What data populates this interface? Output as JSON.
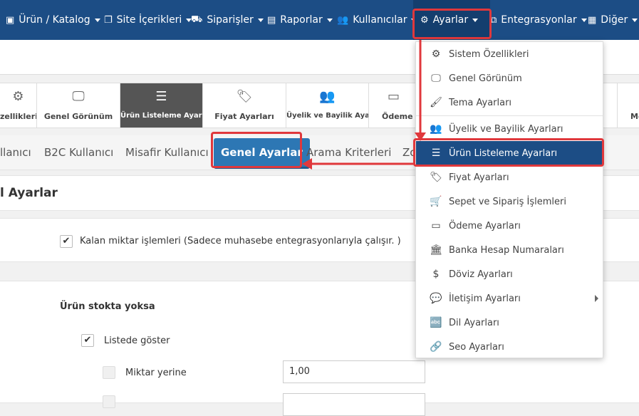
{
  "topnav": {
    "items": [
      {
        "label": "Ürün / Katalog",
        "icon": "cubes-icon"
      },
      {
        "label": "Site İçerikleri",
        "icon": "copy-icon"
      },
      {
        "label": "Siparişler",
        "icon": "truck-icon"
      },
      {
        "label": "Raporlar",
        "icon": "file-chart-icon"
      },
      {
        "label": "Kullanıcılar",
        "icon": "users-icon"
      },
      {
        "label": "Ayarlar",
        "icon": "gears-icon"
      },
      {
        "label": "Entegrasyonlar",
        "icon": "sitemap-icon"
      },
      {
        "label": "Diğer",
        "icon": "grid-icon"
      }
    ]
  },
  "tiles": [
    {
      "label": "zellikleri",
      "icon": "gear-icon"
    },
    {
      "label": "Genel Görünüm",
      "icon": "monitor-icon"
    },
    {
      "label": "Ürün Listeleme Ayarları",
      "icon": "list-icon"
    },
    {
      "label": "Fiyat Ayarları",
      "icon": "tags-icon"
    },
    {
      "label": "Üyelik ve Bayilik Ayarla",
      "icon": "users-icon"
    },
    {
      "label": "Ödeme A",
      "icon": "credit-card-icon"
    },
    {
      "label": "Me",
      "icon": "envelope-icon"
    }
  ],
  "subtabs": [
    "llanıcı",
    "B2C Kullanıcı",
    "Misafir Kullanıcı",
    "Genel Ayarlar",
    "Arama Kriterleri",
    "Zo"
  ],
  "main": {
    "section_title": "l Ayarlar",
    "kalan_label": "Kalan miktar işlemleri (Sadece muhasebe entegrasyonlarıyla çalışır. )",
    "stock_title": "Ürün stokta yoksa",
    "listede_label": "Listede göster",
    "miktar_label": "Miktar yerine",
    "miktar_value": "1,00"
  },
  "dropdown": {
    "items": [
      {
        "label": "Sistem Özellikleri",
        "icon": "gears-icon"
      },
      {
        "label": "Genel Görünüm",
        "icon": "monitor-icon"
      },
      {
        "label": "Tema Ayarları",
        "icon": "brush-icon"
      },
      {
        "label": "Üyelik ve Bayilik Ayarları",
        "icon": "users-icon"
      },
      {
        "label": "Ürün Listeleme Ayarları",
        "icon": "list-icon"
      },
      {
        "label": "Fiyat Ayarları",
        "icon": "tags-icon"
      },
      {
        "label": "Sepet ve Sipariş İşlemleri",
        "icon": "basket-icon"
      },
      {
        "label": "Ödeme Ayarları",
        "icon": "credit-card-icon"
      },
      {
        "label": "Banka Hesap Numaraları",
        "icon": "bank-icon"
      },
      {
        "label": "Döviz Ayarları",
        "icon": "dollar-icon"
      },
      {
        "label": "İletişim Ayarları",
        "icon": "comments-icon"
      },
      {
        "label": "Dil Ayarları",
        "icon": "language-icon"
      },
      {
        "label": "Seo Ayarları",
        "icon": "link-icon"
      }
    ]
  },
  "colors": {
    "nav_bg": "#1c4d85",
    "active_blue": "#2d77b4",
    "highlight_red": "#e0383c",
    "tile_active": "#555555"
  }
}
